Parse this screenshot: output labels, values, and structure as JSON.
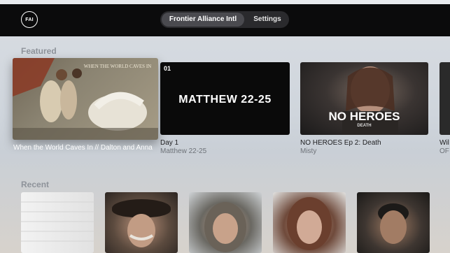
{
  "app": {
    "logo_text": "FAI"
  },
  "top_nav": {
    "tabs": [
      {
        "label": "Frontier Alliance Intl",
        "selected": true
      },
      {
        "label": "Settings",
        "selected": false
      }
    ]
  },
  "featured": {
    "title": "Featured",
    "items": [
      {
        "thumb_title": "WHEN THE WORLD CAVES IN",
        "title": "When the World Caves In // Dalton and Anna",
        "subtitle": ""
      },
      {
        "thumb_number": "01",
        "thumb_title": "MATTHEW 22-25",
        "title": "Day 1",
        "subtitle": "Matthew 22-25"
      },
      {
        "thumb_title": "NO HEROES",
        "thumb_subtitle": "DEATH",
        "title": "NO HEROES Ep 2: Death",
        "subtitle": "Misty"
      },
      {
        "title": "Wil",
        "subtitle": "OF"
      }
    ]
  },
  "recent": {
    "title": "Recent",
    "items": [
      "recent-1",
      "recent-2",
      "recent-3",
      "recent-4",
      "recent-5"
    ]
  },
  "colors": {
    "topbar": "#0b0b0c",
    "tab_active": "#4a4a4f",
    "section_title": "#8e939a"
  }
}
